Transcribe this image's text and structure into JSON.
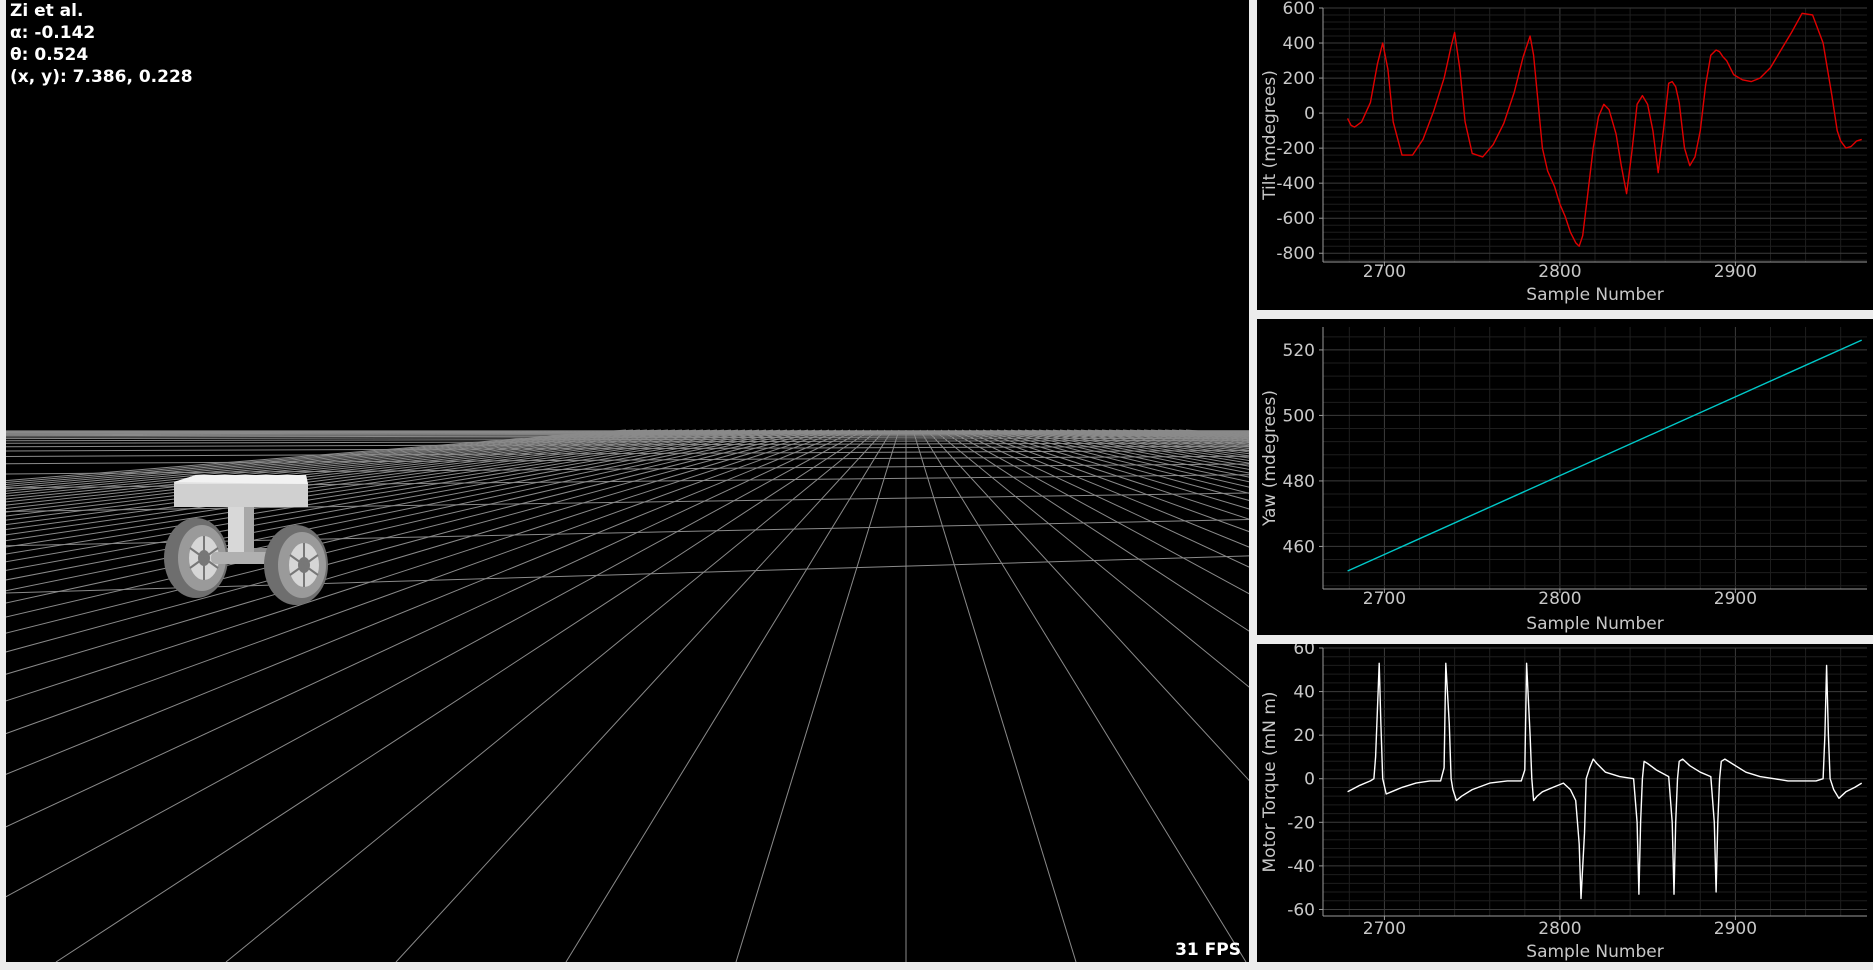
{
  "overlay": {
    "title": "Zi et al.",
    "alpha": "α: -0.142",
    "theta": "θ: 0.524",
    "position": "(x, y): 7.386, 0.228"
  },
  "fps": "31 FPS",
  "chart_data": [
    {
      "type": "line",
      "xlabel": "Sample Number",
      "ylabel": "Tilt (mdegrees)",
      "xlim": [
        2665,
        2975
      ],
      "ylim": [
        -850,
        600
      ],
      "xticks": [
        2700,
        2800,
        2900
      ],
      "yticks": [
        600,
        400,
        200,
        0,
        -200,
        -400,
        -600,
        -800
      ],
      "grid": true,
      "color": "#e00000",
      "series": [
        {
          "x": [
            2679,
            2681,
            2683,
            2687,
            2692,
            2696,
            2699,
            2702,
            2705,
            2710,
            2716,
            2722,
            2728,
            2734,
            2738,
            2740,
            2743,
            2746,
            2750,
            2756,
            2762,
            2768,
            2774,
            2779,
            2783,
            2785,
            2787,
            2790,
            2793,
            2797,
            2800,
            2803,
            2806,
            2809,
            2811,
            2813,
            2816,
            2819,
            2822,
            2825,
            2828,
            2832,
            2835,
            2838,
            2841,
            2844,
            2847,
            2850,
            2853,
            2856,
            2859,
            2862,
            2864,
            2866,
            2868,
            2871,
            2874,
            2877,
            2880,
            2883,
            2886,
            2889,
            2891,
            2893,
            2895,
            2899,
            2904,
            2909,
            2914,
            2920,
            2926,
            2932,
            2938,
            2944,
            2950,
            2955,
            2958,
            2960,
            2963,
            2966,
            2969,
            2972
          ],
          "y": [
            -30,
            -70,
            -80,
            -50,
            60,
            280,
            400,
            250,
            -50,
            -240,
            -240,
            -150,
            10,
            200,
            380,
            460,
            250,
            -50,
            -230,
            -250,
            -180,
            -60,
            120,
            320,
            440,
            330,
            120,
            -200,
            -330,
            -420,
            -520,
            -590,
            -680,
            -740,
            -760,
            -700,
            -450,
            -200,
            -20,
            50,
            20,
            -120,
            -300,
            -460,
            -220,
            50,
            100,
            50,
            -100,
            -340,
            -100,
            170,
            180,
            150,
            60,
            -200,
            -300,
            -250,
            -100,
            160,
            330,
            360,
            350,
            320,
            300,
            220,
            190,
            180,
            200,
            260,
            360,
            460,
            570,
            560,
            400,
            100,
            -100,
            -160,
            -200,
            -190,
            -160,
            -150
          ]
        }
      ]
    },
    {
      "type": "line",
      "xlabel": "Sample Number",
      "ylabel": "Yaw (mdegrees)",
      "xlim": [
        2665,
        2975
      ],
      "ylim": [
        447,
        527
      ],
      "xticks": [
        2700,
        2800,
        2900
      ],
      "yticks": [
        520,
        500,
        480,
        460
      ],
      "grid": true,
      "color": "#00c8c8",
      "series": [
        {
          "x": [
            2679,
            2972
          ],
          "y": [
            452.5,
            523
          ]
        }
      ]
    },
    {
      "type": "line",
      "xlabel": "Sample Number",
      "ylabel": "Motor Torque (mN m)",
      "xlim": [
        2665,
        2975
      ],
      "ylim": [
        -63,
        60
      ],
      "xticks": [
        2700,
        2800,
        2900
      ],
      "yticks": [
        60,
        40,
        20,
        0,
        -20,
        -40,
        -60
      ],
      "grid": true,
      "color": "#ffffff",
      "series": [
        {
          "x": [
            2679,
            2686,
            2692,
            2694,
            2695,
            2697,
            2698,
            2699,
            2701,
            2704,
            2710,
            2718,
            2726,
            2732,
            2734,
            2735,
            2737,
            2738,
            2739,
            2741,
            2744,
            2750,
            2760,
            2770,
            2778,
            2780,
            2781,
            2783,
            2784,
            2785,
            2787,
            2790,
            2796,
            2802,
            2806,
            2809,
            2811,
            2812,
            2814,
            2815,
            2817,
            2819,
            2821,
            2826,
            2834,
            2842,
            2844,
            2845,
            2846,
            2847,
            2848,
            2850,
            2855,
            2862,
            2864,
            2865,
            2866,
            2867,
            2868,
            2870,
            2874,
            2880,
            2886,
            2888,
            2889,
            2890,
            2891,
            2892,
            2894,
            2898,
            2906,
            2914,
            2922,
            2930,
            2938,
            2946,
            2950,
            2951,
            2952,
            2953,
            2954,
            2956,
            2959,
            2963,
            2968,
            2972
          ],
          "y": [
            -6,
            -3,
            -1,
            0,
            10,
            53,
            25,
            0,
            -7,
            -6,
            -4,
            -2,
            -1,
            -1,
            5,
            53,
            25,
            0,
            -5,
            -10,
            -8,
            -5,
            -2,
            -1,
            -1,
            4,
            53,
            20,
            0,
            -10,
            -8,
            -6,
            -4,
            -2,
            -5,
            -10,
            -30,
            -55,
            -25,
            0,
            5,
            9,
            7,
            3,
            1,
            0,
            -20,
            -53,
            -20,
            0,
            8,
            7,
            4,
            1,
            -20,
            -53,
            -20,
            0,
            8,
            9,
            6,
            3,
            1,
            -20,
            -52,
            -20,
            0,
            8,
            9,
            7,
            3,
            1,
            0,
            -1,
            -1,
            -1,
            0,
            20,
            52,
            20,
            0,
            -5,
            -9,
            -6,
            -4,
            -2
          ]
        }
      ]
    }
  ]
}
